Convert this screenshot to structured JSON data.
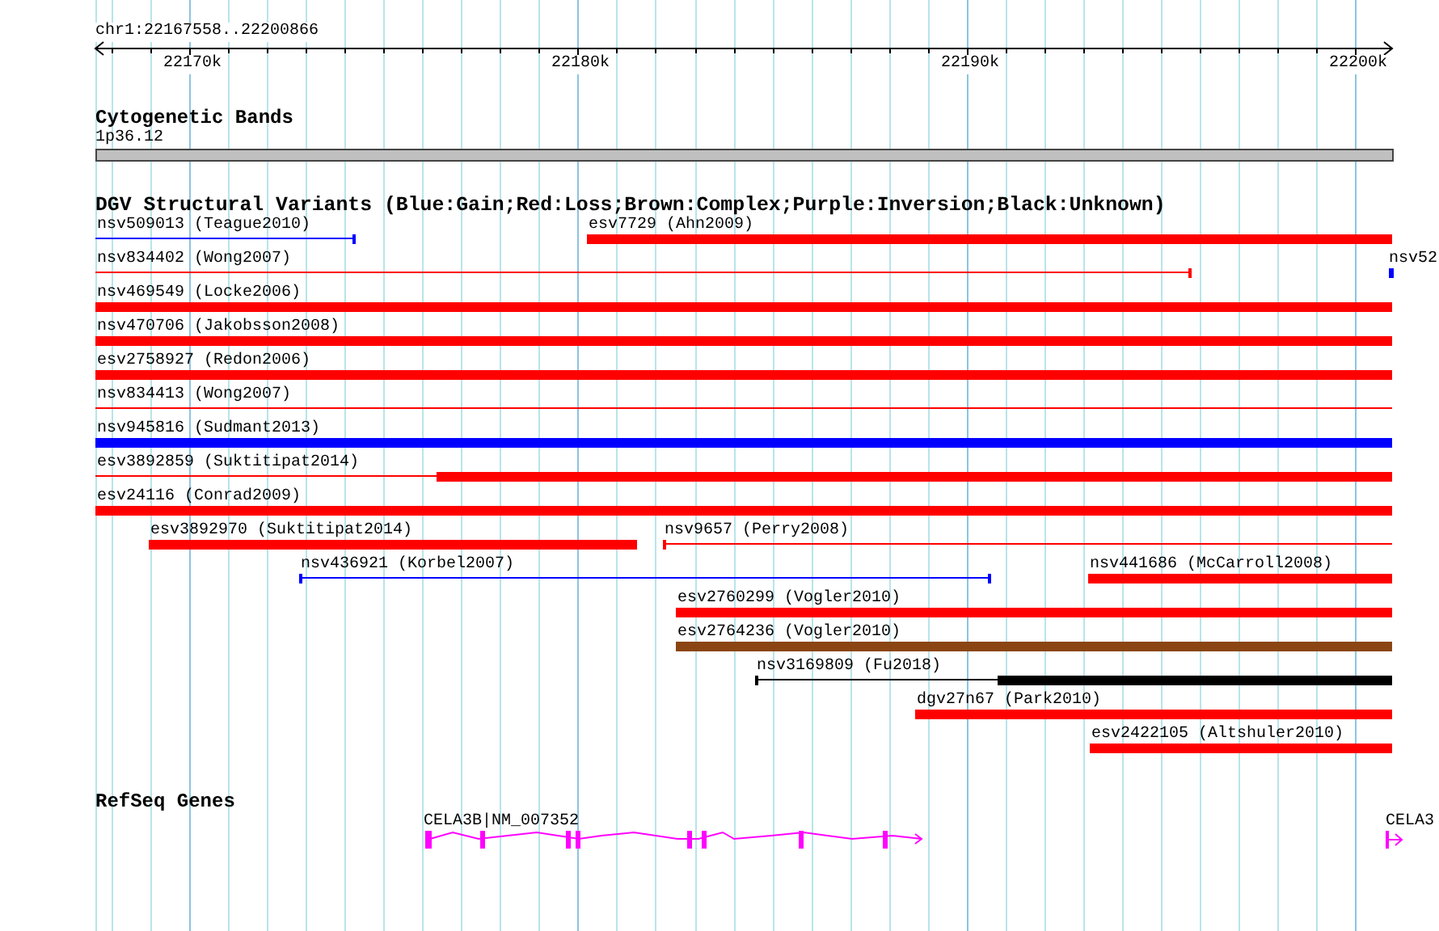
{
  "ruler": {
    "location": "chr1:22167558..22200866",
    "ticks": [
      "22170k",
      "22180k",
      "22190k",
      "22200k"
    ]
  },
  "cytogenetic_bands": {
    "title": "Cytogenetic Bands",
    "band": "1p36.12"
  },
  "variants": {
    "title": "DGV Structural Variants (Blue:Gain;Red:Loss;Brown:Complex;Purple:Inversion;Black:Unknown)",
    "features": [
      {
        "label": "nsv509013 (Teague2010)",
        "kind": "line",
        "color": "#0000ff"
      },
      {
        "label": "esv7729 (Ahn2009)",
        "kind": "bar",
        "color": "#ff0000"
      },
      {
        "label": "nsv834402 (Wong2007)",
        "kind": "line",
        "color": "#ff0000"
      },
      {
        "label": "nsv52",
        "kind": "bar",
        "color": "#0000ff"
      },
      {
        "label": "nsv469549 (Locke2006)",
        "kind": "bar",
        "color": "#ff0000"
      },
      {
        "label": "nsv470706 (Jakobsson2008)",
        "kind": "bar",
        "color": "#ff0000"
      },
      {
        "label": "esv2758927 (Redon2006)",
        "kind": "bar",
        "color": "#ff0000"
      },
      {
        "label": "nsv834413 (Wong2007)",
        "kind": "line",
        "color": "#ff0000"
      },
      {
        "label": "nsv945816 (Sudmant2013)",
        "kind": "bar",
        "color": "#0000ff"
      },
      {
        "label": "esv3892859 (Suktitipat2014)",
        "kind": "mixed",
        "color": "#ff0000"
      },
      {
        "label": "esv24116 (Conrad2009)",
        "kind": "bar",
        "color": "#ff0000"
      },
      {
        "label": "esv3892970 (Suktitipat2014)",
        "kind": "bar",
        "color": "#ff0000"
      },
      {
        "label": "nsv9657 (Perry2008)",
        "kind": "line",
        "color": "#ff0000"
      },
      {
        "label": "nsv436921 (Korbel2007)",
        "kind": "line",
        "color": "#0000ff"
      },
      {
        "label": "nsv441686 (McCarroll2008)",
        "kind": "bar",
        "color": "#ff0000"
      },
      {
        "label": "esv2760299 (Vogler2010)",
        "kind": "bar",
        "color": "#ff0000"
      },
      {
        "label": "esv2764236 (Vogler2010)",
        "kind": "bar",
        "color": "#8b4513"
      },
      {
        "label": "nsv3169809 (Fu2018)",
        "kind": "mixed",
        "color": "#000000"
      },
      {
        "label": "dgv27n67 (Park2010)",
        "kind": "bar",
        "color": "#ff0000"
      },
      {
        "label": "esv2422105 (Altshuler2010)",
        "kind": "bar",
        "color": "#ff0000"
      }
    ]
  },
  "genes": {
    "title": "RefSeq Genes",
    "features": [
      {
        "label": "CELA3B|NM_007352"
      },
      {
        "label": "CELA3"
      }
    ]
  }
}
